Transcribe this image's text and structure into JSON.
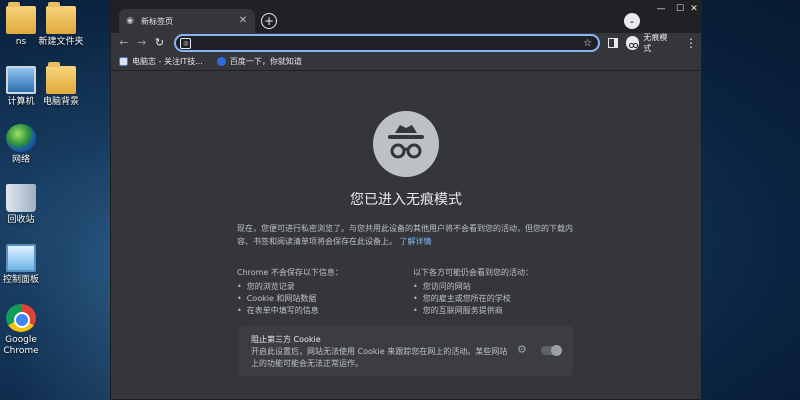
{
  "desktop": {
    "icons": [
      {
        "label": "ns",
        "icon": "folder-icon"
      },
      {
        "label": "新建文件夹",
        "icon": "folder-icon"
      },
      {
        "label": "计算机",
        "icon": "computer-icon"
      },
      {
        "label": "电脑背景",
        "icon": "folder-icon"
      },
      {
        "label": "网络",
        "icon": "network-globe-icon"
      },
      {
        "label": "回收站",
        "icon": "recycle-bin-icon"
      },
      {
        "label": "控制面板",
        "icon": "control-panel-icon"
      },
      {
        "label": "Google Chrome",
        "icon": "chrome-icon"
      }
    ]
  },
  "browser": {
    "tab": {
      "title": "新标签页",
      "icon": "incognito-icon"
    },
    "new_tab_symbol": "+",
    "tab_search_symbol": "⌄",
    "window_controls": {
      "minimize": "—",
      "maximize": "☐",
      "close": "✕"
    },
    "omnibox": {
      "value": "",
      "placeholder": ""
    },
    "profile_label": "无痕模式",
    "bookmarks": [
      {
        "label": "电脑志 - 关注IT技..."
      },
      {
        "label": "百度一下，你就知道"
      }
    ]
  },
  "incognito_page": {
    "heading": "您已进入无痕模式",
    "intro": "现在，您便可进行私密浏览了。与您共用此设备的其他用户将不会看到您的活动，但您的下载内容、书签和阅读清单项将会保存在此设备上。",
    "learn_more": "了解详情",
    "not_saved": {
      "title": "Chrome 不会保存以下信息：",
      "items": [
        "您的浏览记录",
        "Cookie 和网站数据",
        "在表单中填写的信息"
      ]
    },
    "may_see": {
      "title": "以下各方可能仍会看到您的活动：",
      "items": [
        "您访问的网站",
        "您的雇主或您所在的学校",
        "您的互联网服务提供商"
      ]
    },
    "cookie_box": {
      "title": "阻止第三方 Cookie",
      "text": "开启此设置后，网站无法使用 Cookie 来跟踪您在网上的活动。某些网站上的功能可能会无法正常运作。",
      "toggle_on": true
    }
  },
  "colors": {
    "chrome_dark": "#202124",
    "page_bg": "#35363a",
    "accent_blue": "#8ab4f8"
  }
}
